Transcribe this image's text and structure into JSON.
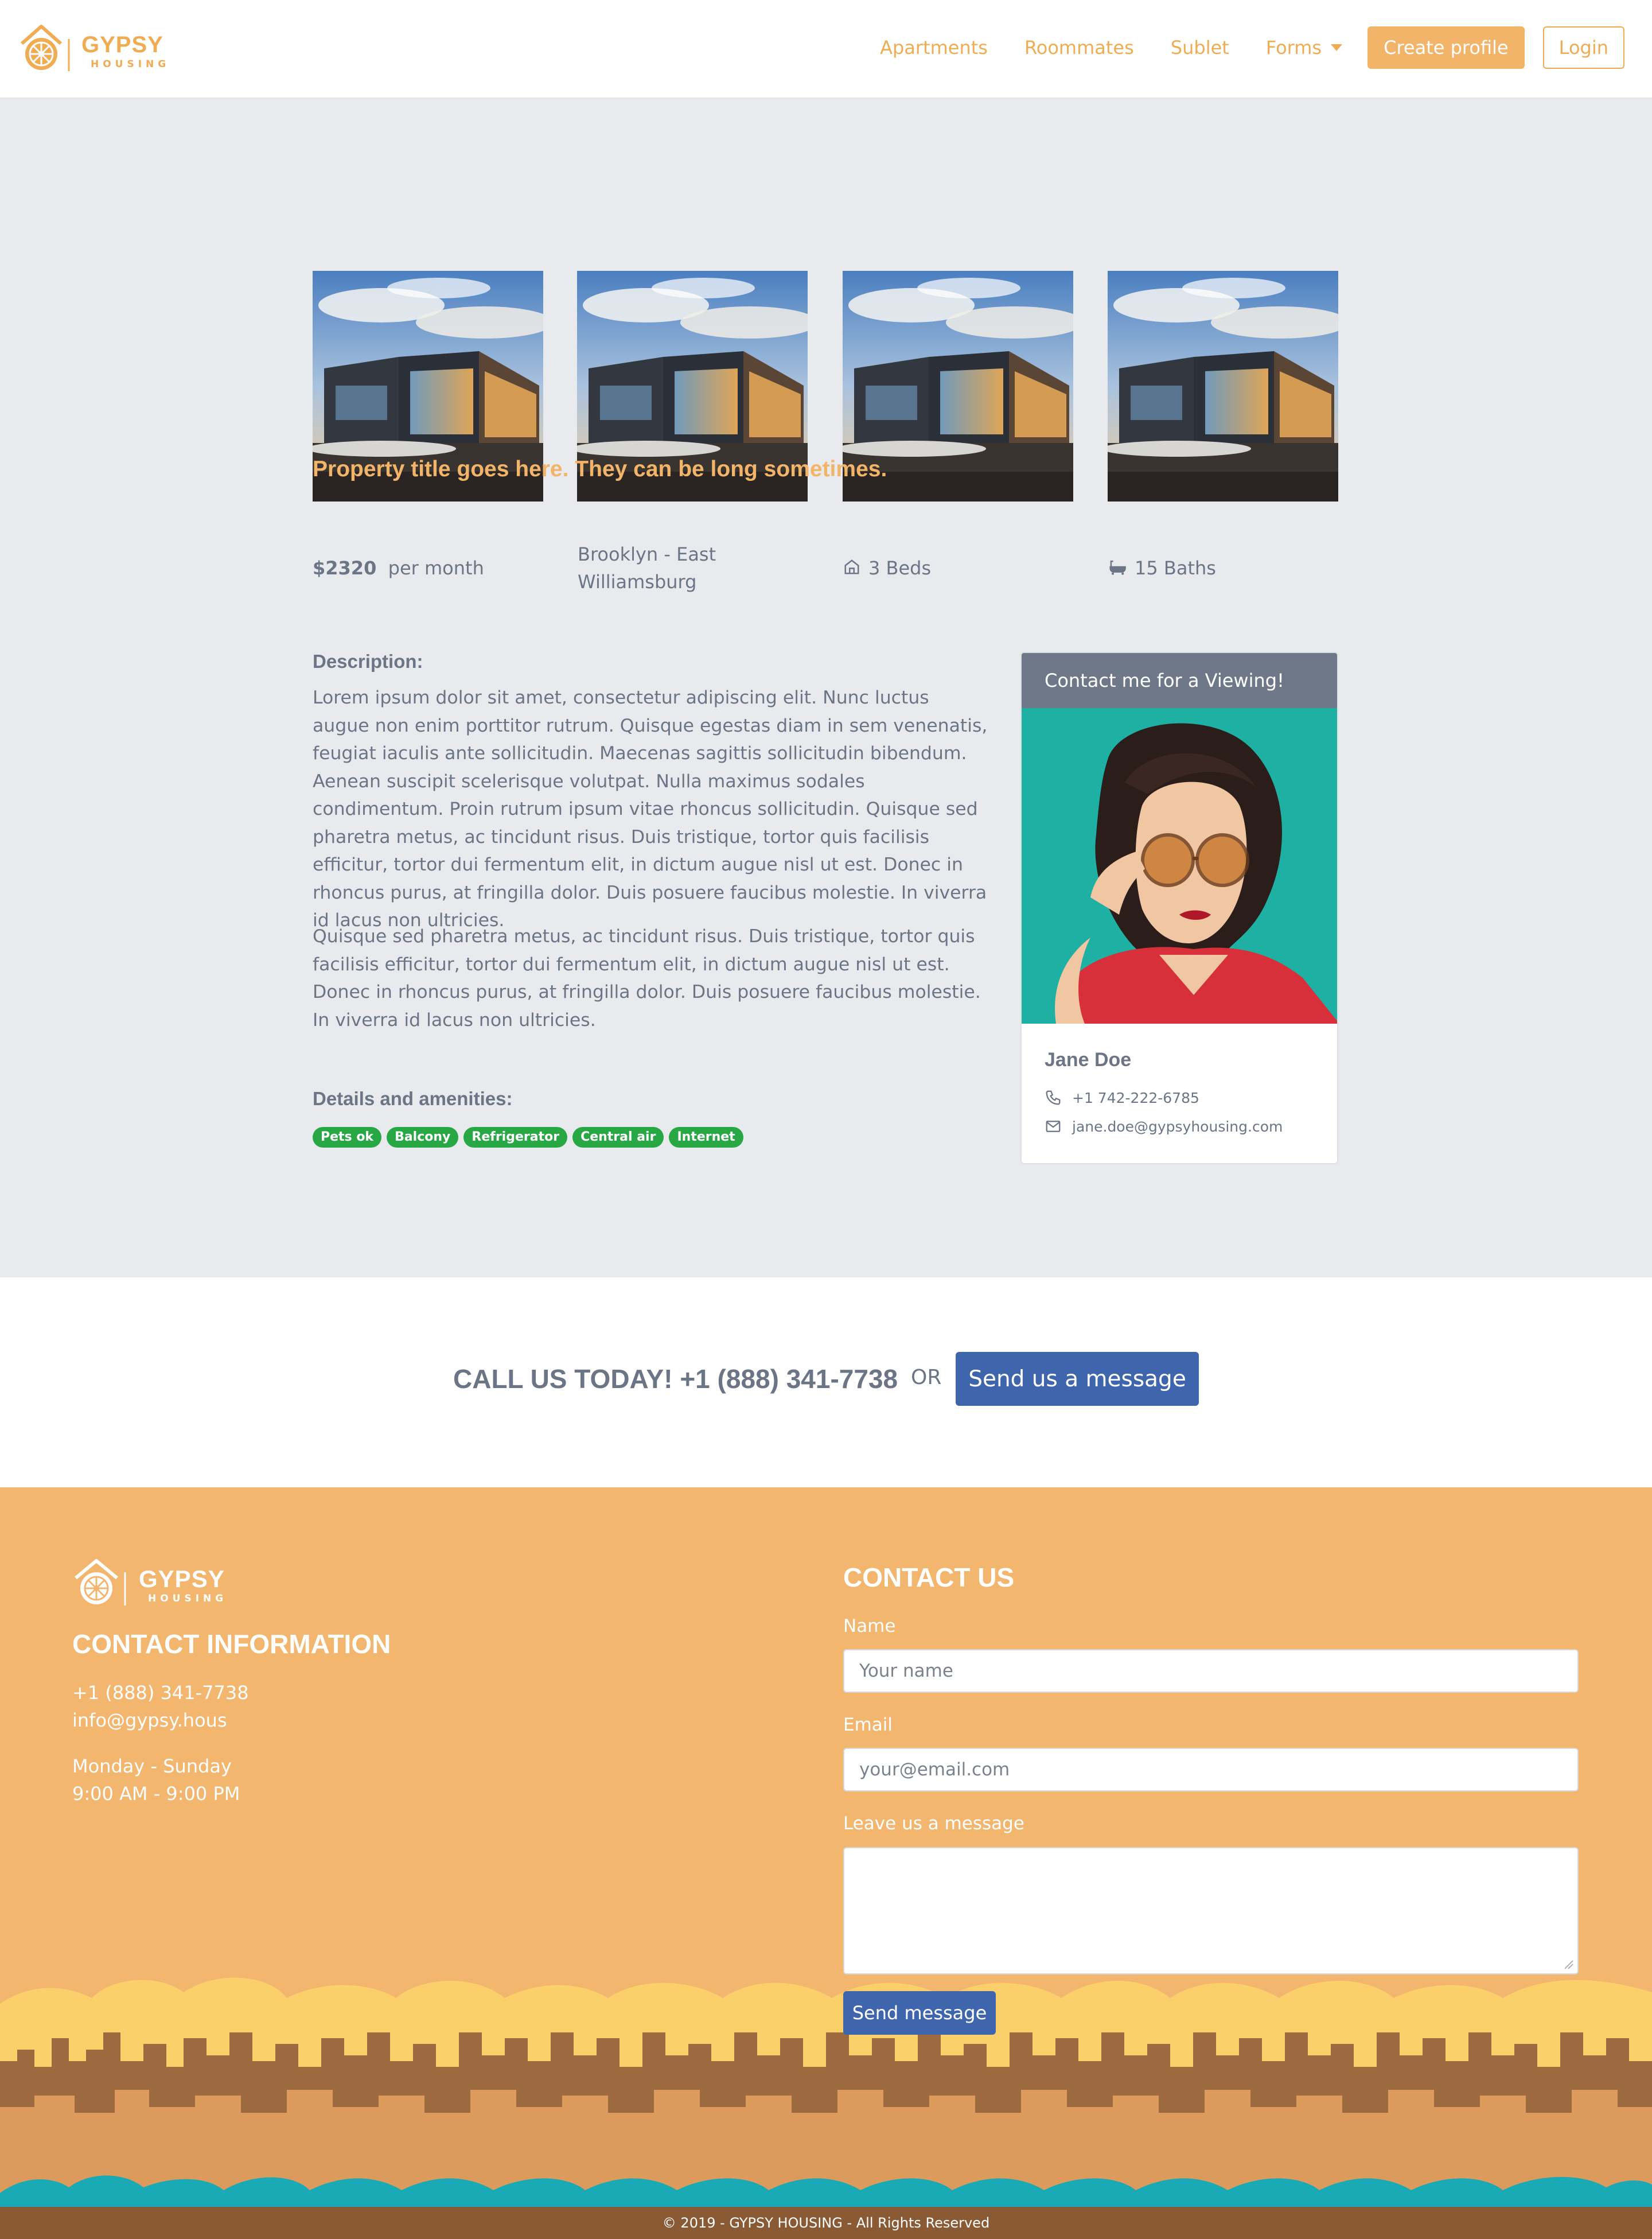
{
  "brand": {
    "name": "GYPSY",
    "sub": "HOUSING",
    "color": "#f0ac52"
  },
  "nav": {
    "items": [
      "Apartments",
      "Roommates",
      "Sublet",
      "Forms"
    ],
    "create_profile": "Create profile",
    "login": "Login"
  },
  "listing": {
    "title": "Property title goes here. They can be long sometimes.",
    "price": "$2320",
    "price_unit": "per month",
    "location_line1": "Brooklyn - East",
    "location_line2": "Williamsburg",
    "beds": "3 Beds",
    "baths": "15 Baths",
    "description_heading": "Description:",
    "description_p1": "Lorem ipsum dolor sit amet, consectetur adipiscing elit. Nunc luctus augue non enim porttitor rutrum. Quisque egestas diam in sem venenatis, feugiat iaculis ante sollicitudin. Maecenas sagittis sollicitudin bibendum. Aenean suscipit scelerisque volutpat. Nulla maximus sodales condimentum. Proin rutrum ipsum vitae rhoncus sollicitudin. Quisque sed pharetra metus, ac tincidunt risus. Duis tristique, tortor quis facilisis efficitur, tortor dui fermentum elit, in dictum augue nisl ut est. Donec in rhoncus purus, at fringilla dolor. Duis posuere faucibus molestie. In viverra id lacus non ultricies.",
    "description_p2": "Quisque sed pharetra metus, ac tincidunt risus. Duis tristique, tortor quis facilisis efficitur, tortor dui fermentum elit, in dictum augue nisl ut est. Donec in rhoncus purus, at fringilla dolor. Duis posuere faucibus molestie. In viverra id lacus non ultricies.",
    "amenities_heading": "Details and amenities:",
    "amenities": [
      "Pets ok",
      "Balcony",
      "Refrigerator",
      "Central air",
      "Internet"
    ],
    "amenity_color": "#28a745"
  },
  "contact_card": {
    "header": "Contact me for a Viewing!",
    "name": "Jane Doe",
    "phone": "+1 742-222-6785",
    "email": "jane.doe@gypsyhousing.com"
  },
  "cta": {
    "text": "CALL US TODAY! +1 (888) 341-7738",
    "or": "OR",
    "button": "Send us a message"
  },
  "footer": {
    "contact_info_heading": "CONTACT INFORMATION",
    "phone": "+1 (888) 341-7738",
    "email": "info@gypsy.hous",
    "days": "Monday - Sunday",
    "hours": "9:00 AM - 9:00 PM",
    "contact_us_heading": "CONTACT US",
    "name_label": "Name",
    "name_placeholder": "Your name",
    "email_label": "Email",
    "email_placeholder": "your@email.com",
    "message_label": "Leave us a message",
    "send_button": "Send message",
    "copyright": "© 2019 - GYPSY HOUSING - All Rights Reserved"
  }
}
